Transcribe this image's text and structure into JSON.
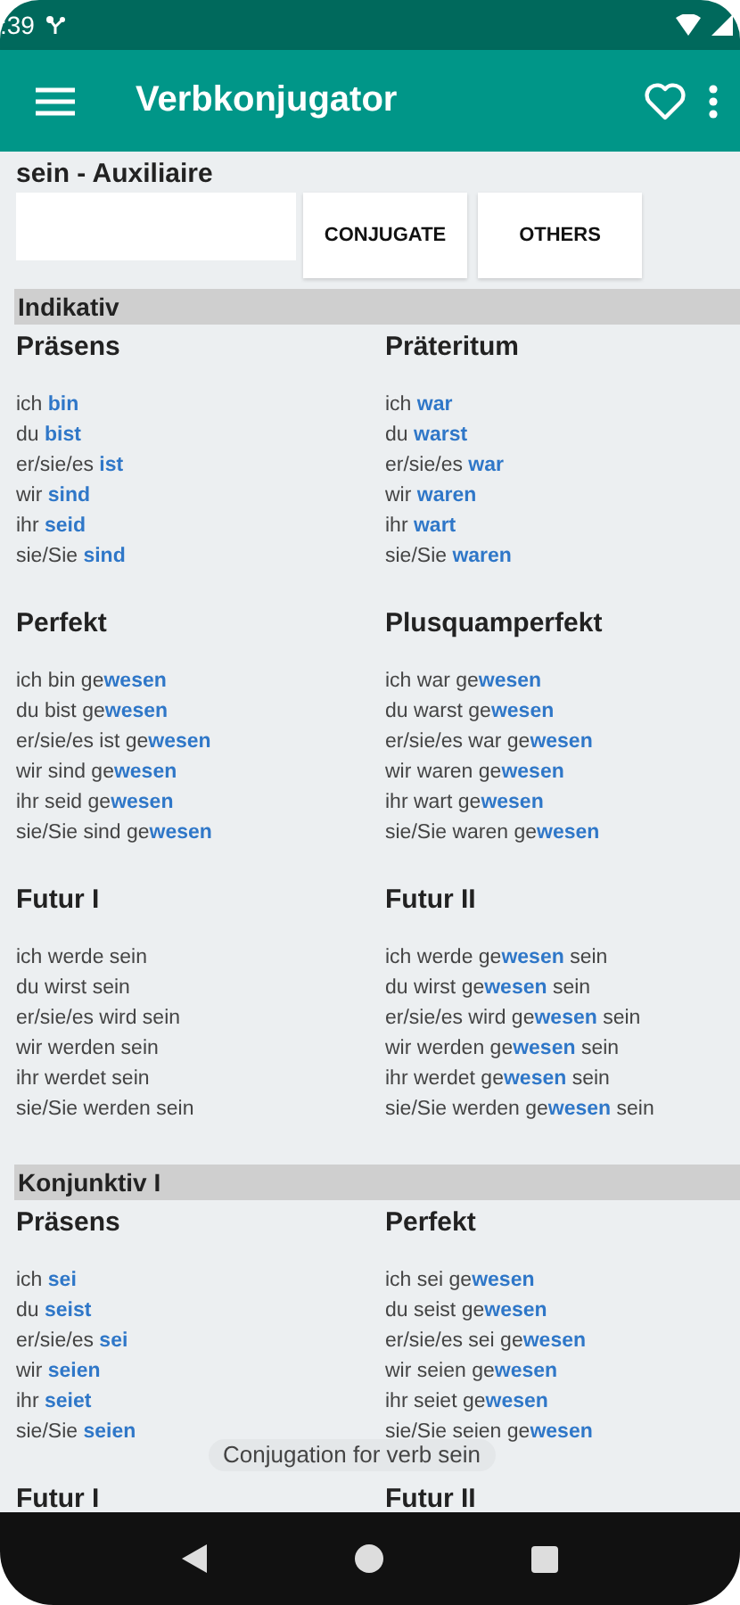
{
  "status_bar": {
    "time": ":39"
  },
  "app_bar": {
    "title": "Verbkonjugator"
  },
  "verb_title": "sein - Auxiliaire",
  "buttons": [
    "CONJUGATE",
    "OTHERS"
  ],
  "moods": [
    {
      "name": "Indikativ",
      "tenses": [
        {
          "name": "Präsens",
          "forms": [
            "ich **bin**",
            "du **bist**",
            "er/sie/es **ist**",
            "wir **sind**",
            "ihr **seid**",
            "sie/Sie **sind**"
          ]
        },
        {
          "name": "Präteritum",
          "forms": [
            "ich **war**",
            "du **warst**",
            "er/sie/es **war**",
            "wir **waren**",
            "ihr **wart**",
            "sie/Sie **waren**"
          ]
        },
        {
          "name": "Perfekt",
          "forms": [
            "ich bin ge**wesen**",
            "du bist ge**wesen**",
            "er/sie/es ist ge**wesen**",
            "wir sind ge**wesen**",
            "ihr seid ge**wesen**",
            "sie/Sie sind ge**wesen**"
          ]
        },
        {
          "name": "Plusquamperfekt",
          "forms": [
            "ich war ge**wesen**",
            "du warst ge**wesen**",
            "er/sie/es war ge**wesen**",
            "wir waren ge**wesen**",
            "ihr wart ge**wesen**",
            "sie/Sie waren ge**wesen**"
          ]
        },
        {
          "name": "Futur I",
          "forms": [
            "ich werde sein",
            "du wirst sein",
            "er/sie/es wird sein",
            "wir werden sein",
            "ihr werdet sein",
            "sie/Sie werden sein"
          ]
        },
        {
          "name": "Futur II",
          "forms": [
            "ich werde ge**wesen** sein",
            "du wirst ge**wesen** sein",
            "er/sie/es wird ge**wesen** sein",
            "wir werden ge**wesen** sein",
            "ihr werdet ge**wesen** sein",
            "sie/Sie werden ge**wesen** sein"
          ]
        }
      ]
    },
    {
      "name": "Konjunktiv I",
      "tenses": [
        {
          "name": "Präsens",
          "forms": [
            "ich **sei**",
            "du **seist**",
            "er/sie/es **sei**",
            "wir **seien**",
            "ihr **seiet**",
            "sie/Sie **seien**"
          ]
        },
        {
          "name": "Perfekt",
          "forms": [
            "ich sei ge**wesen**",
            "du seist ge**wesen**",
            "er/sie/es sei ge**wesen**",
            "wir seien ge**wesen**",
            "ihr seiet ge**wesen**",
            "sie/Sie seien ge**wesen**"
          ]
        },
        {
          "name": "Futur I"
        },
        {
          "name": "Futur II"
        }
      ]
    }
  ],
  "toast": "Conjugation for verb sein"
}
